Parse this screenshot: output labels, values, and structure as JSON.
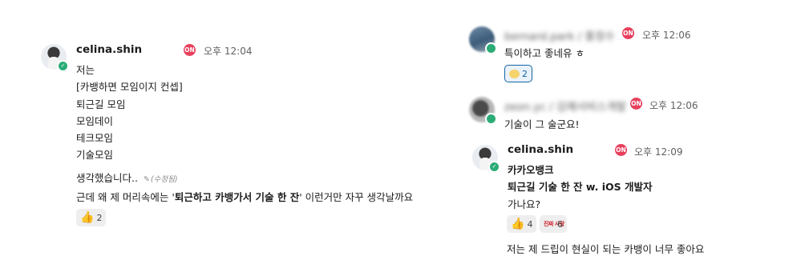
{
  "messages": [
    {
      "user": "celina.shin",
      "badge": "ON",
      "time": "오후 12:04",
      "lines": [
        "저는",
        "[카뱅하면 모임이지 컨셉]",
        "퇴근길 모임",
        "모임데이",
        "테크모임",
        "기술모임"
      ],
      "line7": "생각했습니다..",
      "edited": "(수정됨)",
      "line8_prefix": "근데 왜 제 머리속에는 '",
      "line8_bold": "퇴근하고 카뱅가서 기술 한 잔",
      "line8_suffix": "' 이런거만 자꾸 생각날까요",
      "reactions": [
        {
          "icon": "thumbs-up",
          "count": "2"
        }
      ]
    },
    {
      "user": "bernard.park / 홍정수",
      "badge": "ON",
      "time": "오후 12:06",
      "text": "특이하고 좋네유 ㅎ",
      "reactions": [
        {
          "icon": "smiley-face",
          "count": "2"
        }
      ]
    },
    {
      "user": "zeon.yc / 김예서비스개발",
      "badge": "ON",
      "time": "오후 12:06",
      "text": "기술이 그 술군요!"
    },
    {
      "user": "celina.shin",
      "badge": "ON",
      "time": "오후 12:09",
      "line1": "카카오뱅크",
      "line2": "퇴근길 기술 한 잔 w. iOS 개발자",
      "line3": "가나요?",
      "reactions": [
        {
          "icon": "thumbs-up",
          "count": "4"
        },
        {
          "icon": "custom-text-emoji",
          "label": "진짜 사랑",
          "count": "6"
        }
      ],
      "followup": "저는 제 드립이 현실이 되는 카뱅이 너무 좋아요"
    }
  ],
  "colors": {
    "presence": "#2bac76",
    "on_badge": "#e8405e",
    "active_reaction_border": "#1264a3"
  }
}
